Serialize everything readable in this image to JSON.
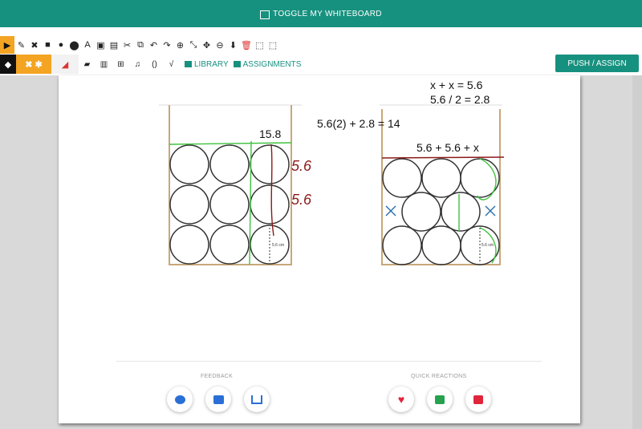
{
  "topbar": {
    "title": "TOGGLE MY WHITEBOARD"
  },
  "toolbar": {
    "row1": [
      "▶",
      "✎",
      "✖",
      "■",
      "●",
      "⬤",
      "A",
      "▣",
      "▤",
      "✂",
      "⧉",
      "↶",
      "↷",
      "⊕",
      "⤡",
      "✥",
      "⊖",
      "⬇",
      "🗑",
      "⬚",
      "⬚"
    ],
    "library_label": "LIBRARY",
    "assignments_label": "ASSIGNMENTS",
    "push_label": "PUSH / ASSIGN"
  },
  "board": {
    "eq_right1": "x + x = 5.6",
    "eq_right2": "5.6 / 2 = 2.8",
    "eq_mid": "5.6(2) + 2.8 = 14",
    "label_158": "15.8",
    "label_sum": "5.6 + 5.6 + x",
    "hand1": "5.6",
    "hand2": "5.6",
    "small_label": "5.6 cm"
  },
  "footer": {
    "feedback_label": "FEEDBACK",
    "reactions_label": "QUICK REACTIONS"
  },
  "colors": {
    "teal": "#17917f",
    "orange": "#f4a423",
    "red": "#e0243a",
    "green": "#27a14e",
    "blue": "#2a6fd6"
  }
}
